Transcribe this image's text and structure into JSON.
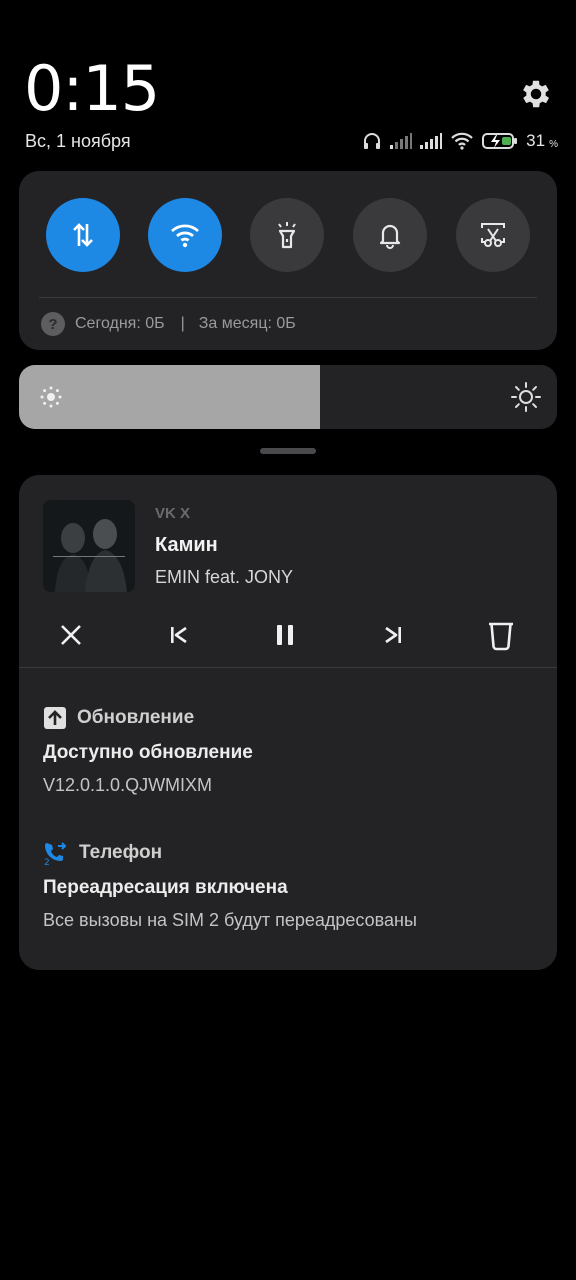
{
  "header": {
    "time": "0:15",
    "date": "Вс, 1 ноября",
    "battery_level": "31",
    "battery_unit": "%"
  },
  "quick_settings": {
    "toggles": [
      {
        "name": "mobile-data",
        "icon": "data-arrows-icon",
        "active": true
      },
      {
        "name": "wifi",
        "icon": "wifi-icon",
        "active": true
      },
      {
        "name": "flashlight",
        "icon": "flashlight-icon",
        "active": false
      },
      {
        "name": "sound",
        "icon": "bell-icon",
        "active": false
      },
      {
        "name": "screenshot",
        "icon": "scissors-screenshot-icon",
        "active": false
      }
    ],
    "traffic_today": "Сегодня: 0Б",
    "traffic_separator": "|",
    "traffic_month": "За месяц: 0Б"
  },
  "brightness": {
    "level_fraction": 0.56
  },
  "media": {
    "app": "VK X",
    "title": "Камин",
    "artist": "EMIN feat. JONY"
  },
  "notifications": [
    {
      "app": "Обновление",
      "icon": "upload-icon",
      "title": "Доступно обновление",
      "body": "V12.0.1.0.QJWMIXM"
    },
    {
      "app": "Телефон",
      "icon": "call-forward-icon",
      "title": "Переадресация включена",
      "body": "Все вызовы на SIM 2 будут переадресованы"
    }
  ],
  "colors": {
    "accent": "#1e88e5",
    "card": "#232325",
    "brightness_fill": "#a6a6a6"
  }
}
